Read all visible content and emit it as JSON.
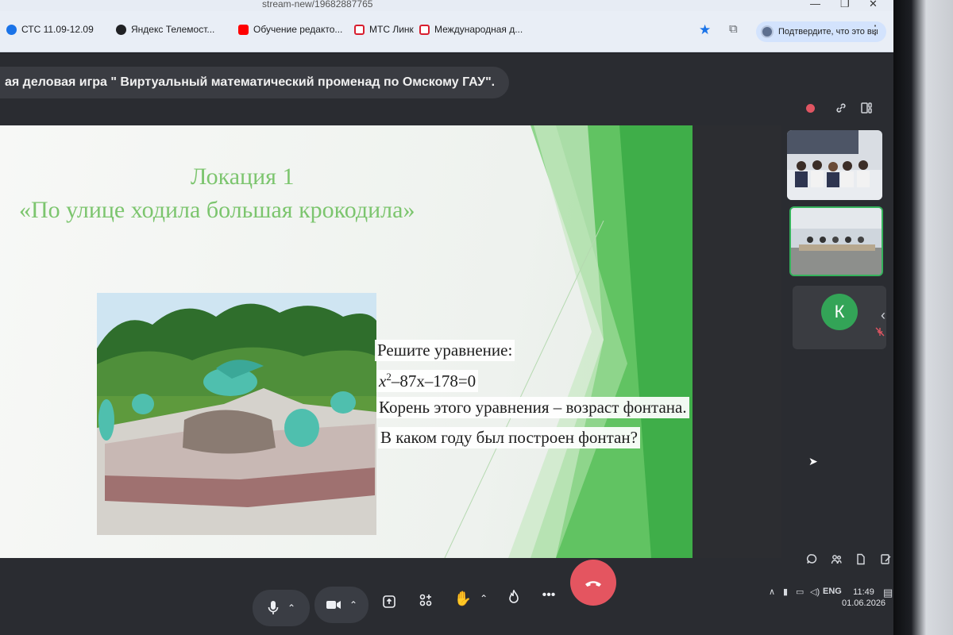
{
  "browser": {
    "url_fragment": "stream-new/19682887765",
    "window_controls": [
      "—",
      "❐",
      "✕"
    ],
    "bookmarks": [
      {
        "label": "СТС 11.09-12.09",
        "icon": "circle-b-icon",
        "color": "#1a73e8"
      },
      {
        "label": "Яндекс Телемост...",
        "icon": "telemost-icon",
        "color": "#202124"
      },
      {
        "label": "Обучение редакто...",
        "icon": "youtube-icon",
        "color": "#ff0000"
      },
      {
        "label": "МТС Линк",
        "icon": "mts-link-icon",
        "color": "#d81e2f"
      },
      {
        "label": "Международная д...",
        "icon": "mts-link-icon",
        "color": "#d81e2f"
      }
    ],
    "profile_label": "Подтвердите, что это вы"
  },
  "meeting": {
    "title": "ая деловая игра \" Виртуальный математический променад по Омскому ГАУ\"."
  },
  "slide": {
    "title": "Локация 1",
    "subtitle": "«По улице ходила большая крокодила»",
    "prompt": "Решите уравнение:",
    "equation_prefix": "x",
    "equation_sup": "2",
    "equation_suffix": "–87x–178=0",
    "line3": "Корень этого уравнения – возраст фонтана.",
    "line4": "В каком году был построен фонтан?"
  },
  "participants": {
    "avatar_letter": "К"
  },
  "controls": {
    "more_label": "•••"
  },
  "taskbar": {
    "lang": "ENG",
    "time": "11:49",
    "date": "01.06.2026"
  },
  "colors": {
    "accent_green": "#35b35c",
    "hangup_red": "#e45560",
    "slide_title_green": "#7cc56e"
  }
}
